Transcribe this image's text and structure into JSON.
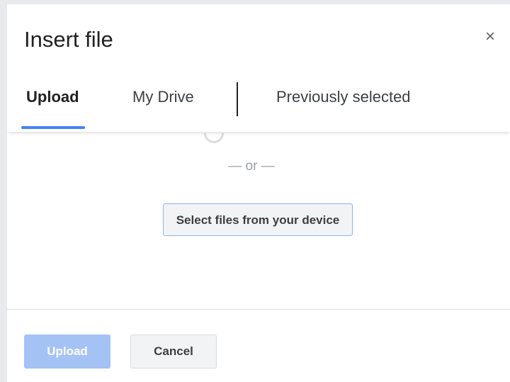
{
  "dialog": {
    "title": "Insert file",
    "close_icon": "close-icon",
    "close_glyph": "×"
  },
  "tabs": [
    {
      "label": "Upload",
      "active": true
    },
    {
      "label": "My Drive",
      "active": false
    },
    {
      "label": "Previously selected",
      "active": false
    }
  ],
  "upload_panel": {
    "separator_text": "— or —",
    "select_button_label": "Select files from your device"
  },
  "footer": {
    "upload_label": "Upload",
    "cancel_label": "Cancel"
  },
  "colors": {
    "accent": "#4285f4",
    "upload_disabled": "#a4c2f4"
  }
}
